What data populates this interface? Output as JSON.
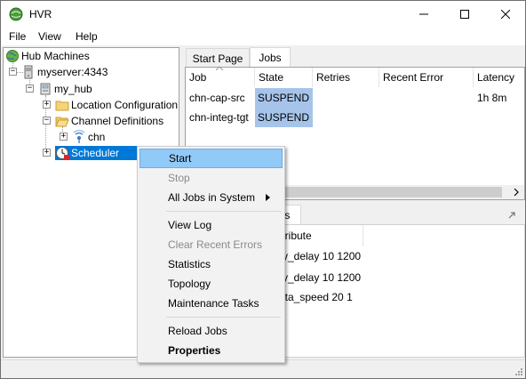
{
  "app": {
    "title": "HVR",
    "accent_selection": "#0078d7",
    "highlight_cell": "#a6c4ea"
  },
  "window_controls": {
    "minimize": "minimize-icon",
    "maximize": "maximize-icon",
    "close": "close-icon"
  },
  "menubar": {
    "items": [
      "File",
      "View",
      "Help"
    ]
  },
  "tree": {
    "root": "Hub Machines",
    "server": "myserver:4343",
    "hub": "my_hub",
    "location_config": "Location Configuration",
    "channel_defs": "Channel Definitions",
    "channel": "chn",
    "scheduler": "Scheduler"
  },
  "top_tabs": [
    "Start Page",
    "Jobs"
  ],
  "jobs_table": {
    "columns": [
      "Job",
      "State",
      "Retries",
      "Recent Error",
      "Latency"
    ],
    "rows": [
      {
        "job": "chn-cap-src",
        "state": "SUSPEND",
        "retries": "",
        "error": "",
        "latency": "1h 8m"
      },
      {
        "job": "chn-integ-tgt",
        "state": "SUSPEND",
        "retries": "",
        "error": "",
        "latency": ""
      }
    ]
  },
  "bottom_panel": {
    "tab_fragment": "es",
    "column_fragment": "ttribute",
    "rows": [
      "ry_delay 10 1200",
      "ry_delay 10 1200",
      "ota_speed 20 1"
    ]
  },
  "context_menu": {
    "items": [
      {
        "label": "Start",
        "state": "highlighted"
      },
      {
        "label": "Stop",
        "state": "disabled"
      },
      {
        "label": "All Jobs in System",
        "state": "submenu"
      },
      {
        "label": "View Log",
        "state": "normal"
      },
      {
        "label": "Clear Recent Errors",
        "state": "disabled"
      },
      {
        "label": "Statistics",
        "state": "normal"
      },
      {
        "label": "Topology",
        "state": "normal"
      },
      {
        "label": "Maintenance Tasks",
        "state": "normal"
      },
      {
        "label": "Reload Jobs",
        "state": "normal"
      },
      {
        "label": "Properties",
        "state": "bold"
      }
    ]
  }
}
